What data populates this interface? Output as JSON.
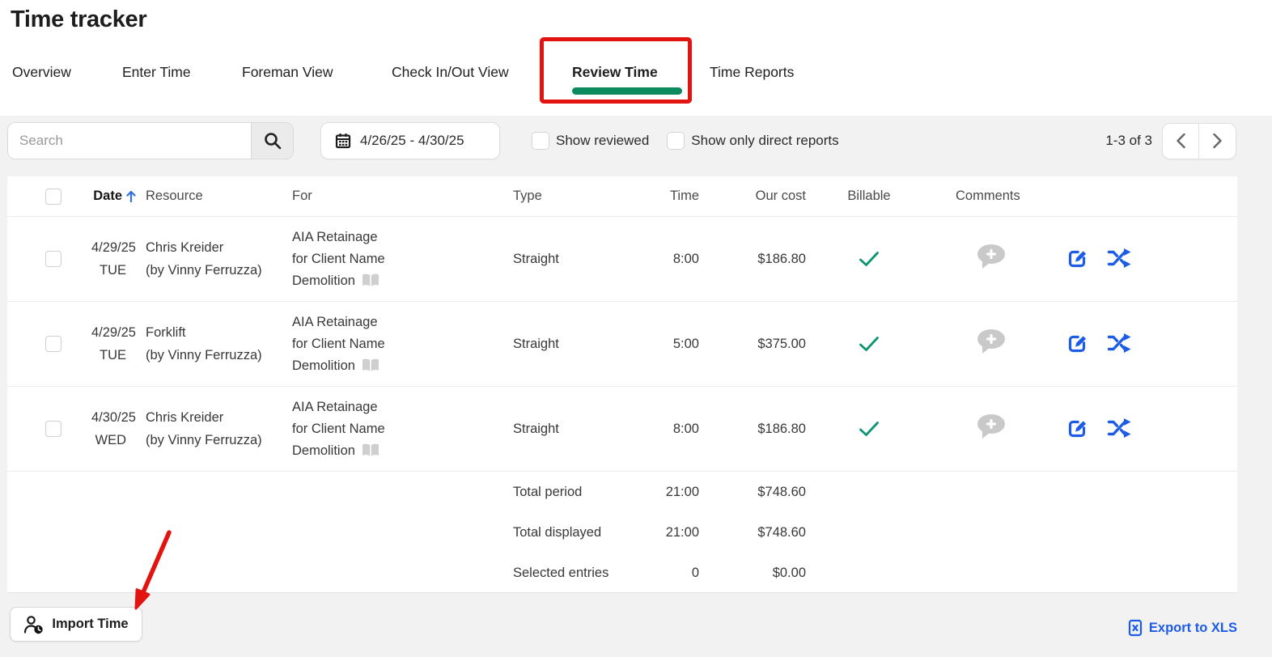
{
  "page": {
    "title": "Time tracker"
  },
  "tabs": [
    {
      "label": "Overview",
      "active": false
    },
    {
      "label": "Enter Time",
      "active": false
    },
    {
      "label": "Foreman View",
      "active": false
    },
    {
      "label": "Check In/Out View",
      "active": false
    },
    {
      "label": "Review Time",
      "active": true,
      "annotated": true
    },
    {
      "label": "Time Reports",
      "active": false
    }
  ],
  "toolbar": {
    "search_placeholder": "Search",
    "date_range": "4/26/25 - 4/30/25",
    "checkboxes": [
      {
        "label": "Show reviewed",
        "checked": false
      },
      {
        "label": "Show only direct reports",
        "checked": false
      }
    ],
    "pagination": {
      "label": "1-3 of 3"
    }
  },
  "table": {
    "columns": {
      "date": "Date",
      "resource": "Resource",
      "for_": "For",
      "type": "Type",
      "time": "Time",
      "our_cost": "Our cost",
      "billable": "Billable",
      "comments": "Comments"
    },
    "sort": {
      "column": "Date",
      "direction": "ascending"
    },
    "rows": [
      {
        "date": "4/29/25",
        "day": "TUE",
        "resource": "Chris Kreider",
        "resource_by": "(by Vinny Ferruzza)",
        "for_line1": "AIA Retainage",
        "for_line2": "for Client Name",
        "for_line3": "Demolition",
        "type": "Straight",
        "time": "8:00",
        "our_cost": "$186.80",
        "billable": true
      },
      {
        "date": "4/29/25",
        "day": "TUE",
        "resource": "Forklift",
        "resource_by": "(by Vinny Ferruzza)",
        "for_line1": "AIA Retainage",
        "for_line2": "for Client Name",
        "for_line3": "Demolition",
        "type": "Straight",
        "time": "5:00",
        "our_cost": "$375.00",
        "billable": true
      },
      {
        "date": "4/30/25",
        "day": "WED",
        "resource": "Chris Kreider",
        "resource_by": "(by Vinny Ferruzza)",
        "for_line1": "AIA Retainage",
        "for_line2": "for Client Name",
        "for_line3": "Demolition",
        "type": "Straight",
        "time": "8:00",
        "our_cost": "$186.80",
        "billable": true
      }
    ],
    "totals": [
      {
        "label": "Total period",
        "time": "21:00",
        "cost": "$748.60"
      },
      {
        "label": "Total displayed",
        "time": "21:00",
        "cost": "$748.60"
      },
      {
        "label": "Selected entries",
        "time": "0",
        "cost": "$0.00"
      }
    ]
  },
  "footer": {
    "import_button": "Import Time",
    "export_link": "Export to XLS"
  },
  "icons": {
    "search": "magnifier",
    "calendar": "calendar-grid",
    "sort": "arrow-up",
    "notes": "open-book",
    "billable": "green-check",
    "comments": "speech-bubble-plus",
    "edit": "pencil-square",
    "move": "shuffle-arrows",
    "prev": "chevron-left",
    "next": "chevron-right",
    "import": "person-clock",
    "export": "spreadsheet-x"
  },
  "colors": {
    "accent_green": "#0d8a5e",
    "icon_blue": "#1d5ce8",
    "check_green": "#0d9472",
    "annotation_red": "#e31410",
    "toolbar_bg": "#f2f2f2"
  }
}
